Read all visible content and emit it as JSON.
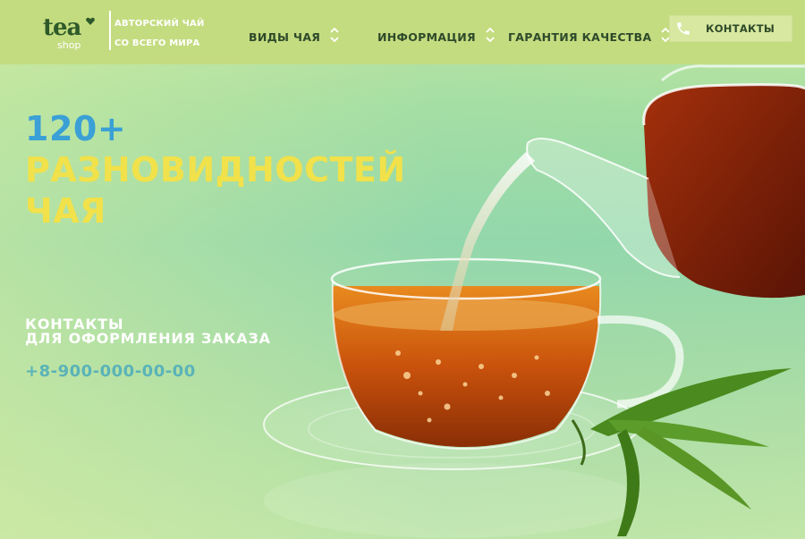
{
  "logo": {
    "word": "tea",
    "sub": "shop"
  },
  "tagline": {
    "line1": "АВТОРСКИЙ ЧАЙ",
    "line2": "СО ВСЕГО МИРА"
  },
  "nav": [
    {
      "label": "ВИДЫ ЧАЯ",
      "icon": "updown-chevron-icon"
    },
    {
      "label": "ИНФОРМАЦИЯ",
      "icon": "updown-chevron-icon"
    },
    {
      "label": "ГАРАНТИЯ КАЧЕСТВА",
      "icon": "updown-chevron-icon"
    }
  ],
  "contacts_button": {
    "label": "КОНТАКТЫ",
    "icon": "phone-icon"
  },
  "hero": {
    "count": "120+",
    "line1": "РАЗНОВИДНОСТЕЙ",
    "line2": "ЧАЯ"
  },
  "order": {
    "title1": "КОНТАКТЫ",
    "title2": "ДЛЯ ОФОРМЛЕНИЯ ЗАКАЗА",
    "phone": "+8-900-000-00-00"
  },
  "colors": {
    "header_bg": "#c4dc80",
    "accent_blue": "#3aa0d6",
    "accent_yellow": "#f1e14a",
    "phone_teal": "#5ab3b8",
    "nav_text": "#2e4a2a"
  }
}
